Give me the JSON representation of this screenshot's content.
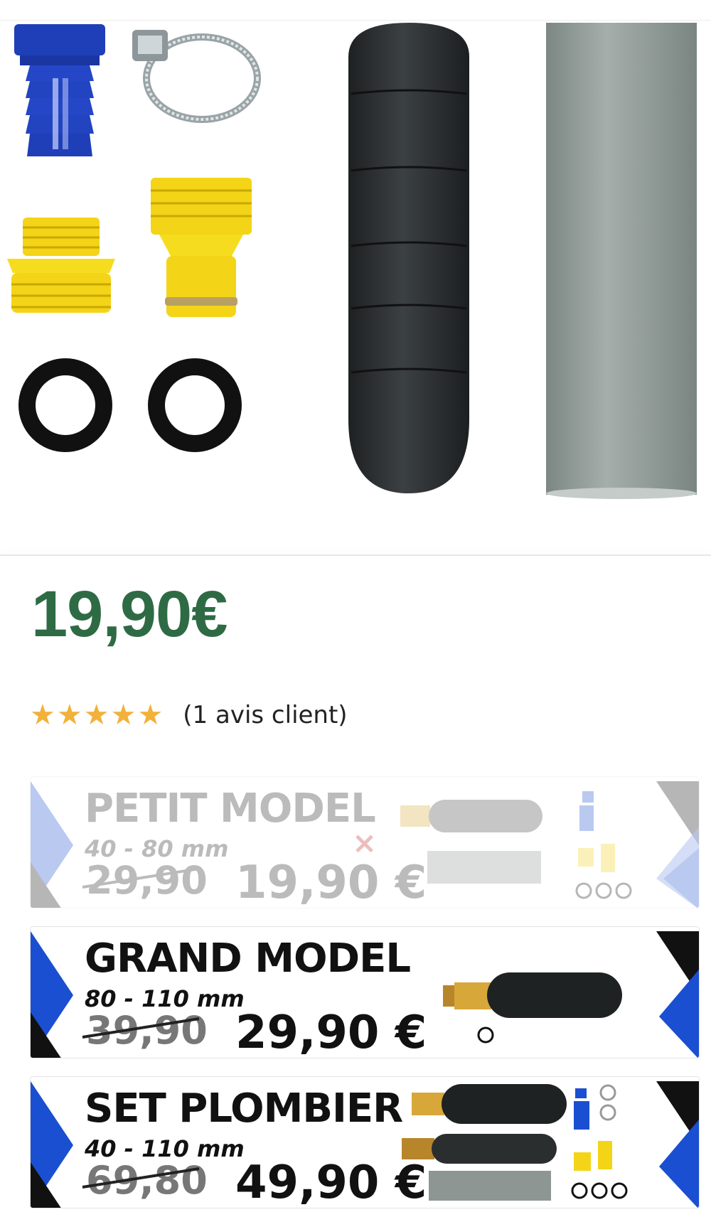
{
  "product": {
    "price": "19,90€",
    "rating_stars": 5,
    "rating_max": 5,
    "review_count_text": "(1 avis client)"
  },
  "colors": {
    "price_green": "#2e6b45",
    "star_gold": "#f2b13a",
    "banner_blue": "#1a4fd1",
    "remove_red": "#c62828"
  },
  "variants": [
    {
      "title": "PETIT MODEL",
      "size": "40 - 80 mm",
      "old_price": "29,90",
      "new_price": "19,90 €",
      "state": "unavailable",
      "remove_icon": "×"
    },
    {
      "title": "GRAND MODEL",
      "size": "80 - 110 mm",
      "old_price": "39,90",
      "new_price": "29,90 €",
      "state": "available"
    },
    {
      "title": "SET PLOMBIER",
      "size": "40 - 110 mm",
      "old_price": "69,80",
      "new_price": "49,90 €",
      "state": "available"
    }
  ]
}
